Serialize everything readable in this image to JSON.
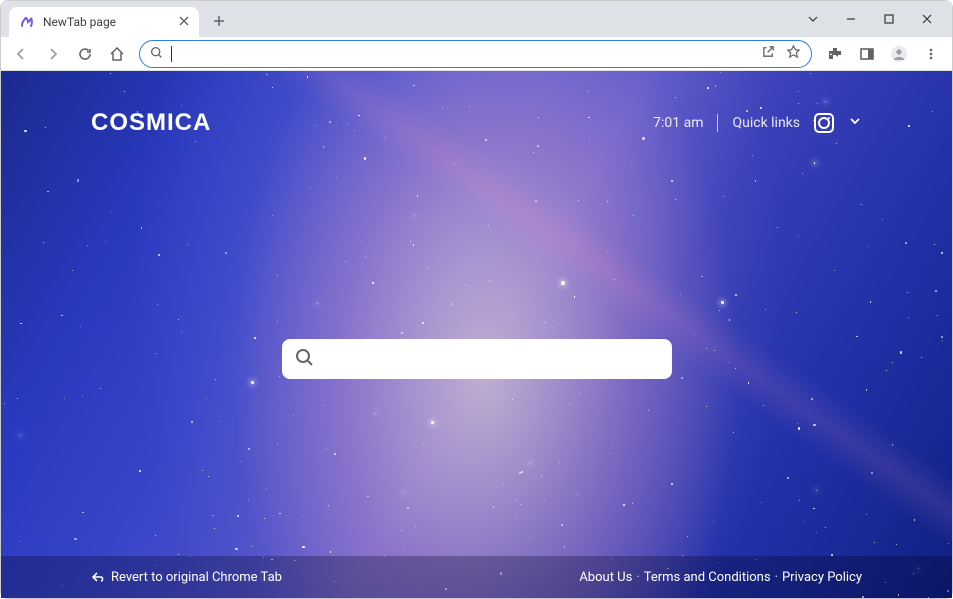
{
  "window": {
    "tab_title": "NewTab page"
  },
  "page": {
    "logo": "COSMICA",
    "time": "7:01 am",
    "quick_links_label": "Quick links",
    "search_placeholder": ""
  },
  "footer": {
    "revert": "Revert to original Chrome Tab",
    "links": {
      "about": "About Us",
      "terms": "Terms and Conditions",
      "privacy": "Privacy Policy"
    },
    "sep": "·"
  }
}
